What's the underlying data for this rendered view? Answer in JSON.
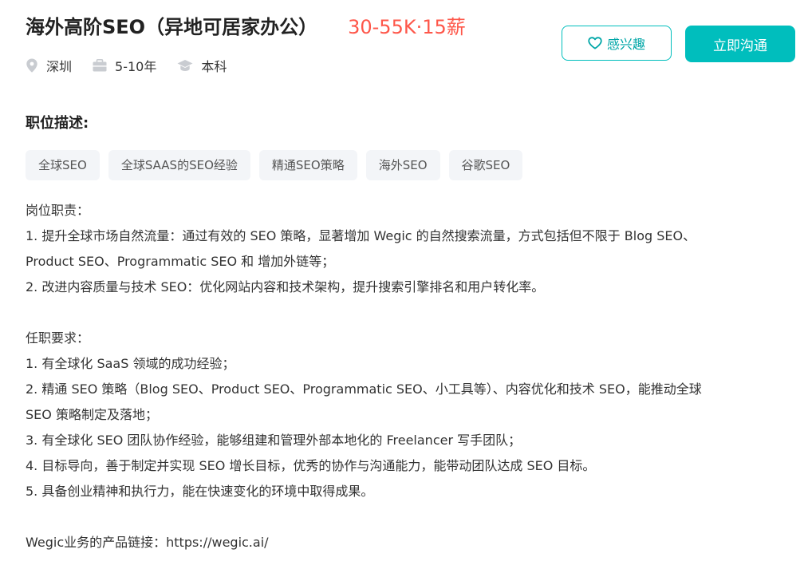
{
  "job": {
    "title": "海外高阶SEO（异地可居家办公）",
    "salary": "30-55K·15薪",
    "location": "深圳",
    "experience": "5-10年",
    "education": "本科"
  },
  "actions": {
    "interest_label": "感兴趣",
    "chat_label": "立即沟通"
  },
  "icons": {
    "location": "location-pin-icon",
    "experience": "briefcase-icon",
    "education": "graduation-cap-icon",
    "interest": "heart-icon"
  },
  "colors": {
    "accent": "#00bebd",
    "salary": "#fe574a",
    "tag_bg": "#f3f5f8"
  },
  "description": {
    "heading": "职位描述:",
    "tags": [
      "全球SEO",
      "全球SAAS的SEO经验",
      "精通SEO策略",
      "海外SEO",
      "谷歌SEO"
    ],
    "lines": [
      "岗位职责：",
      "1. 提升全球市场自然流量：通过有效的 SEO 策略，显著增加 Wegic 的自然搜索流量，方式包括但不限于 Blog SEO、",
      "Product SEO、Programmatic SEO 和 增加外链等；",
      "2. 改进内容质量与技术 SEO：优化网站内容和技术架构，提升搜索引擎排名和用户转化率。",
      "",
      "任职要求：",
      "1. 有全球化 SaaS 领域的成功经验；",
      "2. 精通 SEO 策略（Blog SEO、Product SEO、Programmatic SEO、小工具等）、内容优化和技术 SEO，能推动全球",
      "SEO 策略制定及落地；",
      "3. 有全球化 SEO 团队协作经验，能够组建和管理外部本地化的 Freelancer 写手团队；",
      "4. 目标导向，善于制定并实现 SEO 增长目标，优秀的协作与沟通能力，能带动团队达成 SEO 目标。",
      "5. 具备创业精神和执行力，能在快速变化的环境中取得成果。",
      "",
      "Wegic业务的产品链接：https://wegic.ai/"
    ]
  }
}
